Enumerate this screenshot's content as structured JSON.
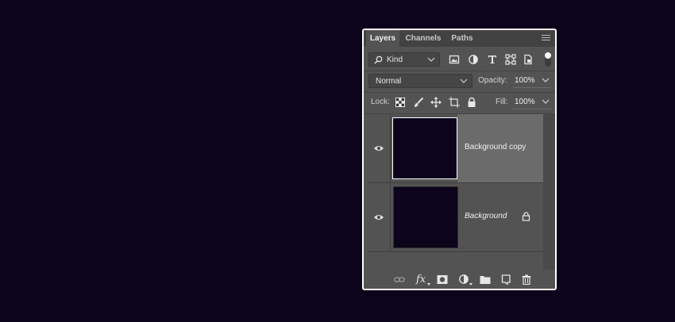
{
  "tabs": [
    {
      "label": "Layers",
      "active": true
    },
    {
      "label": "Channels",
      "active": false
    },
    {
      "label": "Paths",
      "active": false
    }
  ],
  "filter": {
    "kind_label": "Kind"
  },
  "blend": {
    "mode": "Normal",
    "opacity_label": "Opacity:",
    "opacity_value": "100%"
  },
  "lock": {
    "label": "Lock:",
    "fill_label": "Fill:",
    "fill_value": "100%"
  },
  "layers": [
    {
      "name": "Background copy",
      "selected": true,
      "italic": false,
      "locked": false
    },
    {
      "name": "Background",
      "selected": false,
      "italic": true,
      "locked": true
    }
  ],
  "icons": {
    "filter": [
      "image-filter-icon",
      "adjustment-filter-icon",
      "type-filter-icon",
      "shape-filter-icon",
      "smart-object-filter-icon"
    ],
    "lock": [
      "lock-transparent-icon",
      "lock-brush-icon",
      "lock-position-icon",
      "lock-artboard-icon",
      "lock-all-icon"
    ],
    "footer": [
      "link-layers-icon",
      "fx-icon",
      "mask-icon",
      "adjustment-layer-icon",
      "group-folder-icon",
      "new-layer-icon",
      "trash-icon"
    ]
  },
  "colors": {
    "background": "#0c041b",
    "panel": "#535353",
    "selected": "#6b6b6b",
    "thumbnail": "#0c041b"
  }
}
